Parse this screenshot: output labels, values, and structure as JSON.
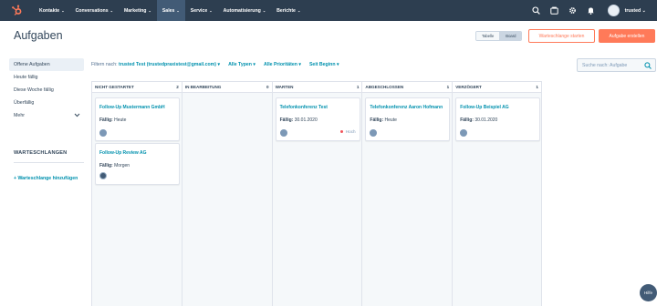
{
  "nav": {
    "items": [
      "Kontakte",
      "Conversations",
      "Marketing",
      "Sales",
      "Service",
      "Automatisierung",
      "Berichte"
    ],
    "active": "Sales",
    "account": "trusted"
  },
  "header": {
    "title": "Aufgaben",
    "view_table": "Tabelle",
    "view_board": "Board",
    "queue_button": "Warteschlange starten",
    "create_button": "Aufgabe erstellen"
  },
  "sidebar": {
    "items": [
      "Offene Aufgaben",
      "Heute fällig",
      "Diese Woche fällig",
      "Überfällig",
      "Mehr"
    ],
    "queues_heading": "WARTESCHLANGEN",
    "add_queue": "+ Warteschlange hinzufügen"
  },
  "filters": {
    "prefix": "Filtern nach:",
    "owner": "trusted Test (trustedpraxistest@gmail.com)",
    "types": "Alle Typen",
    "priorities": "Alle Prioritäten",
    "since": "Seit Beginn",
    "search_placeholder": "Suche nach: Aufgabe"
  },
  "board": {
    "columns": [
      {
        "title": "NICHT GESTARTET",
        "count": "2"
      },
      {
        "title": "IN BEARBEITUNG",
        "count": "0"
      },
      {
        "title": "WARTEN",
        "count": "1"
      },
      {
        "title": "ABGESCHLOSSEN",
        "count": "1"
      },
      {
        "title": "VERZÖGERT",
        "count": "1"
      }
    ],
    "due_label": "Fällig:",
    "cards": {
      "c1": {
        "title": "Follow-Up Mustermann GmbH",
        "due": "Heute"
      },
      "c2": {
        "title": "Follow-Up Review AG",
        "due": "Morgen"
      },
      "c3": {
        "title": "Telefonkonferenz Test",
        "due": "30.01.2020",
        "priority": "Hoch"
      },
      "c4": {
        "title": "Telefonkonferenz Aaron Hofmann",
        "due": "Heute"
      },
      "c5": {
        "title": "Follow-Up Beispiel AG",
        "due": "30.01.2020"
      }
    }
  },
  "help": "Hilfe",
  "colors": {
    "nav_bg": "#2d3e50",
    "accent": "#ff7a59",
    "link": "#0091ae",
    "priority_high": "#f2545b"
  }
}
